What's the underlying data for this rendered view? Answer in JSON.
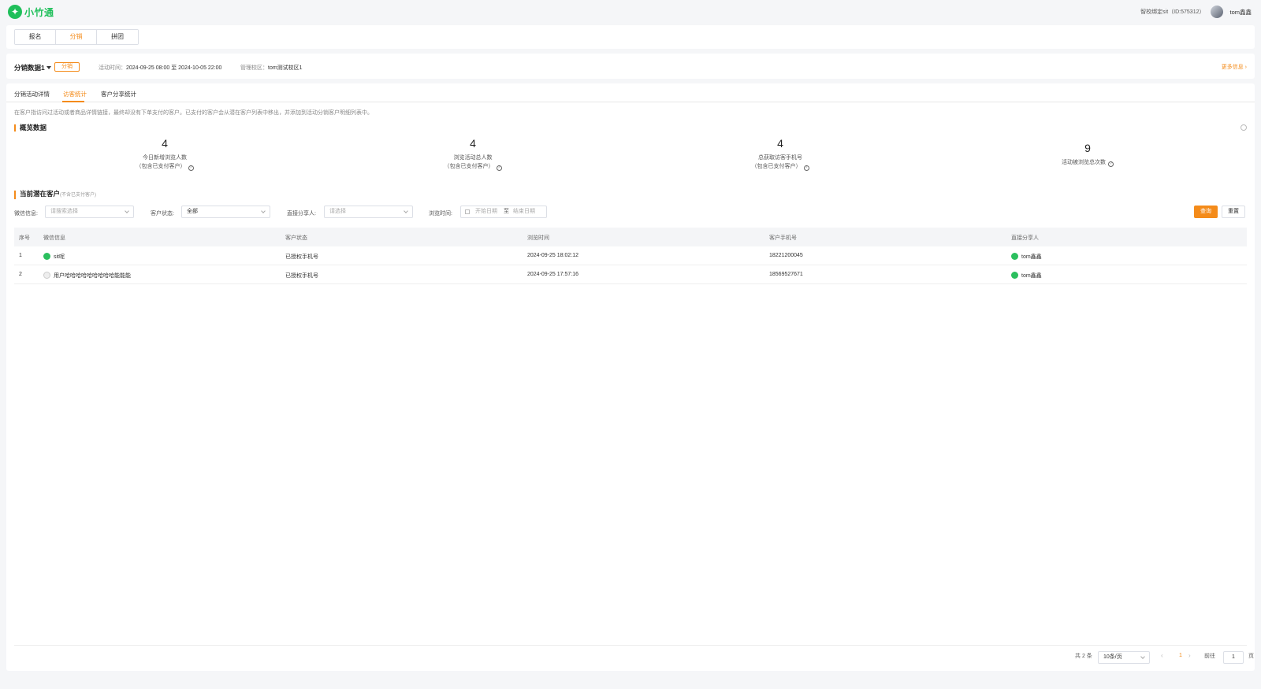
{
  "app": {
    "logo_text": "小竹通",
    "bind_school": "智校绑定sit（ID:575312）",
    "user_name": "tom鑫鑫"
  },
  "top_nav": {
    "items": [
      {
        "label": "报名"
      },
      {
        "label": "分销"
      },
      {
        "label": "拼团"
      }
    ],
    "active": "分销"
  },
  "activity": {
    "name": "分销数据1",
    "tag": "分销",
    "time_label": "活动时间：",
    "time_value": "2024-09-25 08:00 至 2024-10-05 22:00",
    "campus_label": "管理校区：",
    "campus_value": "tom测试校区1",
    "more_link": "更多信息"
  },
  "tabs": [
    {
      "label": "分销活动详情"
    },
    {
      "label": "访客统计"
    },
    {
      "label": "客户分享统计"
    }
  ],
  "active_tab": "访客统计",
  "notice": "在客户指访问过活动或者商品详情链接，最终却没有下单支付的客户。已支付的客户会从潜在客户列表中移出，并添加到活动分销客户明细列表中。",
  "overview": {
    "title": "概览数据",
    "stats": [
      {
        "value": "4",
        "label": "今日新增浏览人数",
        "sub": "（包含已支付客户）"
      },
      {
        "value": "4",
        "label": "浏览活动总人数",
        "sub": "（包含已支付客户）"
      },
      {
        "value": "4",
        "label": "总获取访客手机号",
        "sub": "（包含已支付客户）"
      },
      {
        "value": "9",
        "label": "活动被浏览总次数",
        "sub": ""
      }
    ]
  },
  "potential": {
    "title": "当前潜在客户",
    "subtitle": "(不含已支付客户)",
    "filters": {
      "wechat_label": "微信信息:",
      "wechat_placeholder": "请搜索选择",
      "status_label": "客户状态:",
      "status_value": "全部",
      "sharer_label": "直接分享人:",
      "sharer_placeholder": "请选择",
      "time_label": "浏览时间:",
      "start_placeholder": "开始日期",
      "range_sep": "至",
      "end_placeholder": "结束日期",
      "query_button": "查询",
      "reset_button": "重置"
    },
    "columns": [
      "序号",
      "微信信息",
      "客户状态",
      "浏览时间",
      "客户手机号",
      "直接分享人"
    ],
    "rows": [
      {
        "index": "1",
        "wechat": "sit呢",
        "status": "已授权手机号",
        "time": "2024-09-25 18:02:12",
        "phone": "18221200045",
        "sharer": "tom鑫鑫"
      },
      {
        "index": "2",
        "wechat": "用户哈哈哈哈哈哈哈哈哈能能能",
        "status": "已授权手机号",
        "time": "2024-09-25 17:57:16",
        "phone": "18569527671",
        "sharer": "tom鑫鑫"
      }
    ]
  },
  "pagination": {
    "total": "共 2 条",
    "page_size": "10条/页",
    "current": "1",
    "goto_label": "前往",
    "goto_value": "1",
    "page_suffix": "页"
  },
  "colors": {
    "accent": "#f48b1a",
    "brand": "#1fbf5a"
  },
  "icons": {
    "logo": "leaf-logo-icon",
    "refresh": "refresh-icon",
    "help": "question-icon",
    "calendar": "calendar-icon"
  }
}
